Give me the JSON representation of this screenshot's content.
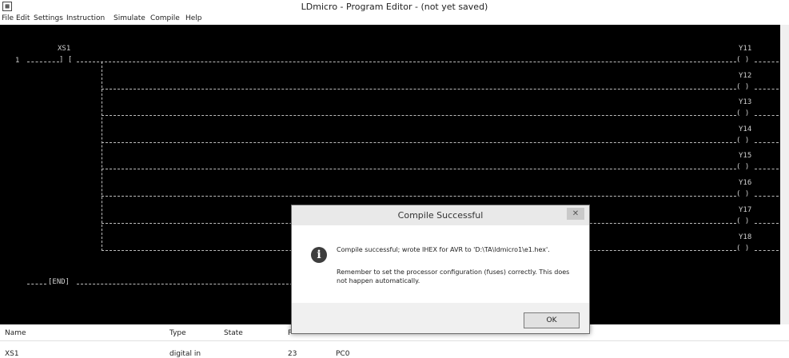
{
  "window": {
    "title": "LDmicro - Program Editor - (not yet saved)",
    "icon": "ldmicro-app-icon"
  },
  "menu": [
    "File",
    "Edit",
    "Settings",
    "Instruction",
    "Simulate",
    "Compile",
    "Help"
  ],
  "editor": {
    "rungs": [
      {
        "number": "1",
        "contact": {
          "name": "XS1",
          "symbol": "] ["
        },
        "coils": [
          {
            "name": "Y11",
            "symbol": "( )"
          },
          {
            "name": "Y12",
            "symbol": "( )"
          },
          {
            "name": "Y13",
            "symbol": "( )"
          },
          {
            "name": "Y14",
            "symbol": "( )"
          },
          {
            "name": "Y15",
            "symbol": "( )"
          },
          {
            "name": "Y16",
            "symbol": "( )"
          },
          {
            "name": "Y17",
            "symbol": "( )"
          },
          {
            "name": "Y18",
            "symbol": "( )"
          }
        ]
      }
    ],
    "end_label": "[END]"
  },
  "io_list": {
    "columns": [
      "Name",
      "Type",
      "State",
      "P"
    ],
    "rows": [
      {
        "name": "XS1",
        "type": "digital in",
        "pin": "23",
        "port": "PC0"
      }
    ]
  },
  "dialog": {
    "title": "Compile Successful",
    "close_label": "✕",
    "icon": "info-icon",
    "message_line1": "Compile successful; wrote IHEX for AVR to 'D:\\TA\\ldmicro1\\e1.hex'.",
    "message_line2": "Remember to set the processor configuration (fuses) correctly. This does not happen automatically.",
    "ok_label": "OK"
  }
}
